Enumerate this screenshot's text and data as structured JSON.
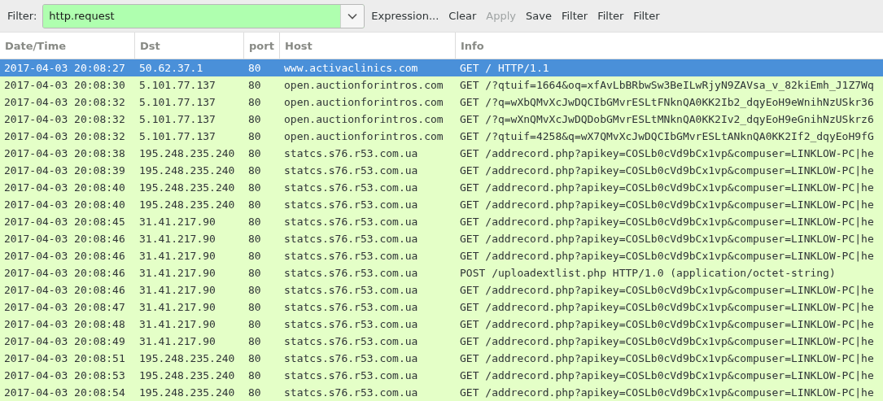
{
  "filter_bar": {
    "label": "Filter:",
    "value": "http.request",
    "buttons": [
      {
        "label": "Expression...",
        "disabled": false
      },
      {
        "label": "Clear",
        "disabled": false
      },
      {
        "label": "Apply",
        "disabled": true
      },
      {
        "label": "Save",
        "disabled": false
      },
      {
        "label": "Filter",
        "disabled": false
      },
      {
        "label": "Filter",
        "disabled": false
      },
      {
        "label": "Filter",
        "disabled": false
      }
    ]
  },
  "table": {
    "columns": [
      "Date/Time",
      "Dst",
      "port",
      "Host",
      "Info"
    ],
    "rows": [
      {
        "selected": true,
        "cells": [
          "2017-04-03 20:08:27",
          "50.62.37.1",
          "80",
          "www.activaclinics.com",
          "GET / HTTP/1.1"
        ]
      },
      {
        "selected": false,
        "cells": [
          "2017-04-03 20:08:30",
          "5.101.77.137",
          "80",
          "open.auctionforintros.com",
          "GET /?qtuif=1664&oq=xfAvLbBRbwSw3BeILwRjyN9ZAVsa_v_82kiEmh_J1Z7Wq"
        ]
      },
      {
        "selected": false,
        "cells": [
          "2017-04-03 20:08:32",
          "5.101.77.137",
          "80",
          "open.auctionforintros.com",
          "GET /?q=wXbQMvXcJwDQCIbGMvrESLtFNknQA0KK2Ib2_dqyEoH9eWnihNzUSkr36"
        ]
      },
      {
        "selected": false,
        "cells": [
          "2017-04-03 20:08:32",
          "5.101.77.137",
          "80",
          "open.auctionforintros.com",
          "GET /?q=wXnQMvXcJwDQDobGMvrESLtMNknQA0KK2Iv2_dqyEoH9eGnihNzUSkrz6"
        ]
      },
      {
        "selected": false,
        "cells": [
          "2017-04-03 20:08:32",
          "5.101.77.137",
          "80",
          "open.auctionforintros.com",
          "GET /?qtuif=4258&q=wX7QMvXcJwDQCIbGMvrESLtANknQA0KK2If2_dqyEoH9fG"
        ]
      },
      {
        "selected": false,
        "cells": [
          "2017-04-03 20:08:38",
          "195.248.235.240",
          "80",
          "statcs.s76.r53.com.ua",
          "GET /addrecord.php?apikey=COSLb0cVd9bCx1vp&compuser=LINKLOW-PC|he"
        ]
      },
      {
        "selected": false,
        "cells": [
          "2017-04-03 20:08:39",
          "195.248.235.240",
          "80",
          "statcs.s76.r53.com.ua",
          "GET /addrecord.php?apikey=COSLb0cVd9bCx1vp&compuser=LINKLOW-PC|he"
        ]
      },
      {
        "selected": false,
        "cells": [
          "2017-04-03 20:08:40",
          "195.248.235.240",
          "80",
          "statcs.s76.r53.com.ua",
          "GET /addrecord.php?apikey=COSLb0cVd9bCx1vp&compuser=LINKLOW-PC|he"
        ]
      },
      {
        "selected": false,
        "cells": [
          "2017-04-03 20:08:40",
          "195.248.235.240",
          "80",
          "statcs.s76.r53.com.ua",
          "GET /addrecord.php?apikey=COSLb0cVd9bCx1vp&compuser=LINKLOW-PC|he"
        ]
      },
      {
        "selected": false,
        "cells": [
          "2017-04-03 20:08:45",
          "31.41.217.90",
          "80",
          "statcs.s76.r53.com.ua",
          "GET /addrecord.php?apikey=COSLb0cVd9bCx1vp&compuser=LINKLOW-PC|he"
        ]
      },
      {
        "selected": false,
        "cells": [
          "2017-04-03 20:08:46",
          "31.41.217.90",
          "80",
          "statcs.s76.r53.com.ua",
          "GET /addrecord.php?apikey=COSLb0cVd9bCx1vp&compuser=LINKLOW-PC|he"
        ]
      },
      {
        "selected": false,
        "cells": [
          "2017-04-03 20:08:46",
          "31.41.217.90",
          "80",
          "statcs.s76.r53.com.ua",
          "GET /addrecord.php?apikey=COSLb0cVd9bCx1vp&compuser=LINKLOW-PC|he"
        ]
      },
      {
        "selected": false,
        "cells": [
          "2017-04-03 20:08:46",
          "31.41.217.90",
          "80",
          "statcs.s76.r53.com.ua",
          "POST /uploadextlist.php HTTP/1.0  (application/octet-string)"
        ]
      },
      {
        "selected": false,
        "cells": [
          "2017-04-03 20:08:46",
          "31.41.217.90",
          "80",
          "statcs.s76.r53.com.ua",
          "GET /addrecord.php?apikey=COSLb0cVd9bCx1vp&compuser=LINKLOW-PC|he"
        ]
      },
      {
        "selected": false,
        "cells": [
          "2017-04-03 20:08:47",
          "31.41.217.90",
          "80",
          "statcs.s76.r53.com.ua",
          "GET /addrecord.php?apikey=COSLb0cVd9bCx1vp&compuser=LINKLOW-PC|he"
        ]
      },
      {
        "selected": false,
        "cells": [
          "2017-04-03 20:08:48",
          "31.41.217.90",
          "80",
          "statcs.s76.r53.com.ua",
          "GET /addrecord.php?apikey=COSLb0cVd9bCx1vp&compuser=LINKLOW-PC|he"
        ]
      },
      {
        "selected": false,
        "cells": [
          "2017-04-03 20:08:49",
          "31.41.217.90",
          "80",
          "statcs.s76.r53.com.ua",
          "GET /addrecord.php?apikey=COSLb0cVd9bCx1vp&compuser=LINKLOW-PC|he"
        ]
      },
      {
        "selected": false,
        "cells": [
          "2017-04-03 20:08:51",
          "195.248.235.240",
          "80",
          "statcs.s76.r53.com.ua",
          "GET /addrecord.php?apikey=COSLb0cVd9bCx1vp&compuser=LINKLOW-PC|he"
        ]
      },
      {
        "selected": false,
        "cells": [
          "2017-04-03 20:08:53",
          "195.248.235.240",
          "80",
          "statcs.s76.r53.com.ua",
          "GET /addrecord.php?apikey=COSLb0cVd9bCx1vp&compuser=LINKLOW-PC|he"
        ]
      },
      {
        "selected": false,
        "cells": [
          "2017-04-03 20:08:54",
          "195.248.235.240",
          "80",
          "statcs.s76.r53.com.ua",
          "GET /addrecord.php?apikey=COSLb0cVd9bCx1vp&compuser=LINKLOW-PC|he"
        ]
      }
    ]
  }
}
